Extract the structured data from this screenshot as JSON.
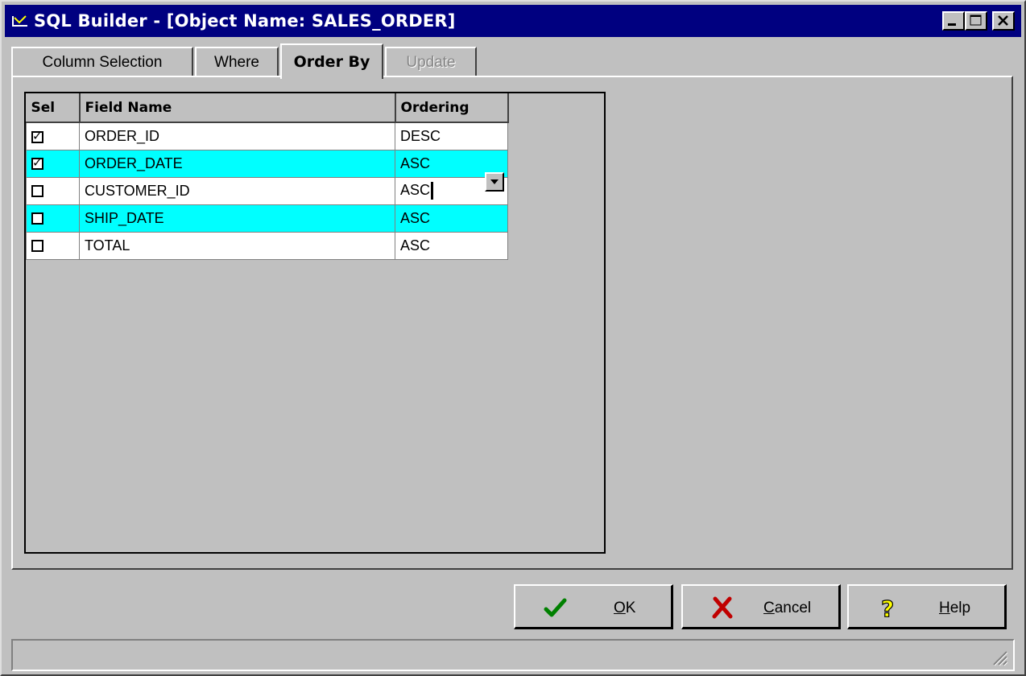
{
  "window": {
    "title": "SQL Builder - [Object Name:  SALES_ORDER]"
  },
  "tabs": [
    {
      "label": "Column Selection",
      "state": "normal"
    },
    {
      "label": "Where",
      "state": "normal"
    },
    {
      "label": "Order By",
      "state": "active"
    },
    {
      "label": "Update",
      "state": "disabled"
    }
  ],
  "grid": {
    "headers": {
      "sel": "Sel",
      "field": "Field Name",
      "ordering": "Ordering"
    },
    "rows": [
      {
        "selected": true,
        "field": "ORDER_ID",
        "ordering": "DESC"
      },
      {
        "selected": true,
        "field": "ORDER_DATE",
        "ordering": "ASC"
      },
      {
        "selected": false,
        "field": "CUSTOMER_ID",
        "ordering": "ASC"
      },
      {
        "selected": false,
        "field": "SHIP_DATE",
        "ordering": "ASC"
      },
      {
        "selected": false,
        "field": "TOTAL",
        "ordering": "ASC"
      }
    ],
    "row_colors": {
      "normal": "#ffffff",
      "alternate": "#00ffff"
    }
  },
  "buttons": {
    "ok": {
      "mnemonic": "O",
      "rest": "K",
      "icon": "checkmark-icon"
    },
    "cancel": {
      "mnemonic": "C",
      "rest": "ancel",
      "icon": "x-icon"
    },
    "help": {
      "mnemonic": "H",
      "rest": "elp",
      "icon": "question-icon"
    }
  },
  "colors": {
    "titlebar": "#000080",
    "face": "#c0c0c0",
    "highlight": "#00ffff"
  }
}
